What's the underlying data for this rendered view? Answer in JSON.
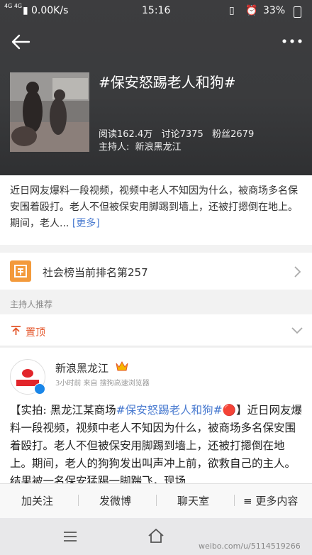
{
  "status_bar": {
    "network": "4G 4G",
    "speed": "0.00K/s",
    "time": "15:16",
    "battery": "33%"
  },
  "topic": {
    "title": "#保安怒踢老人和狗#",
    "reads": "阅读162.4万",
    "discussions": "讨论7375",
    "fans": "粉丝2679",
    "host_label": "主持人:",
    "host_name": "新浪黑龙江"
  },
  "intro": {
    "text": "近日网友爆料一段视频，视频中老人不知因为什么，被商场多名保安围着殴打。老人不但被保安用脚踢到墙上，还被打摁倒在地上。期间，老人... ",
    "more": "[更多]"
  },
  "rank": {
    "label": "社会榜当前排名第257"
  },
  "host_recommend": "主持人推荐",
  "pinned": {
    "label": "置顶"
  },
  "post": {
    "author": "新浪黑龙江",
    "meta": "3小时前  来自 搜狗高速浏览器",
    "prefix": "【实拍: 黑龙江某商场",
    "tag": "#保安怒踢老人和狗#",
    "body": "】近日网友爆料一段视频，视频中老人不知因为什么，被商场多名保安围着殴打。老人不但被保安用脚踢到墙上，还被打摁倒在地上。期间，老人的狗狗发出叫声冲上前，欲救自己的主人。结果被一名保安猛踢一脚踹飞，现场"
  },
  "bottom_bar": {
    "follow": "加关注",
    "post": "发微博",
    "chat": "聊天室",
    "more": "更多内容"
  },
  "watermark": "weibo.com/u/5114519266",
  "colors": {
    "link": "#4a7bd0",
    "accent_orange": "#f39a3b",
    "pinned_red": "#e4572c",
    "verify_blue": "#1a86e8"
  }
}
